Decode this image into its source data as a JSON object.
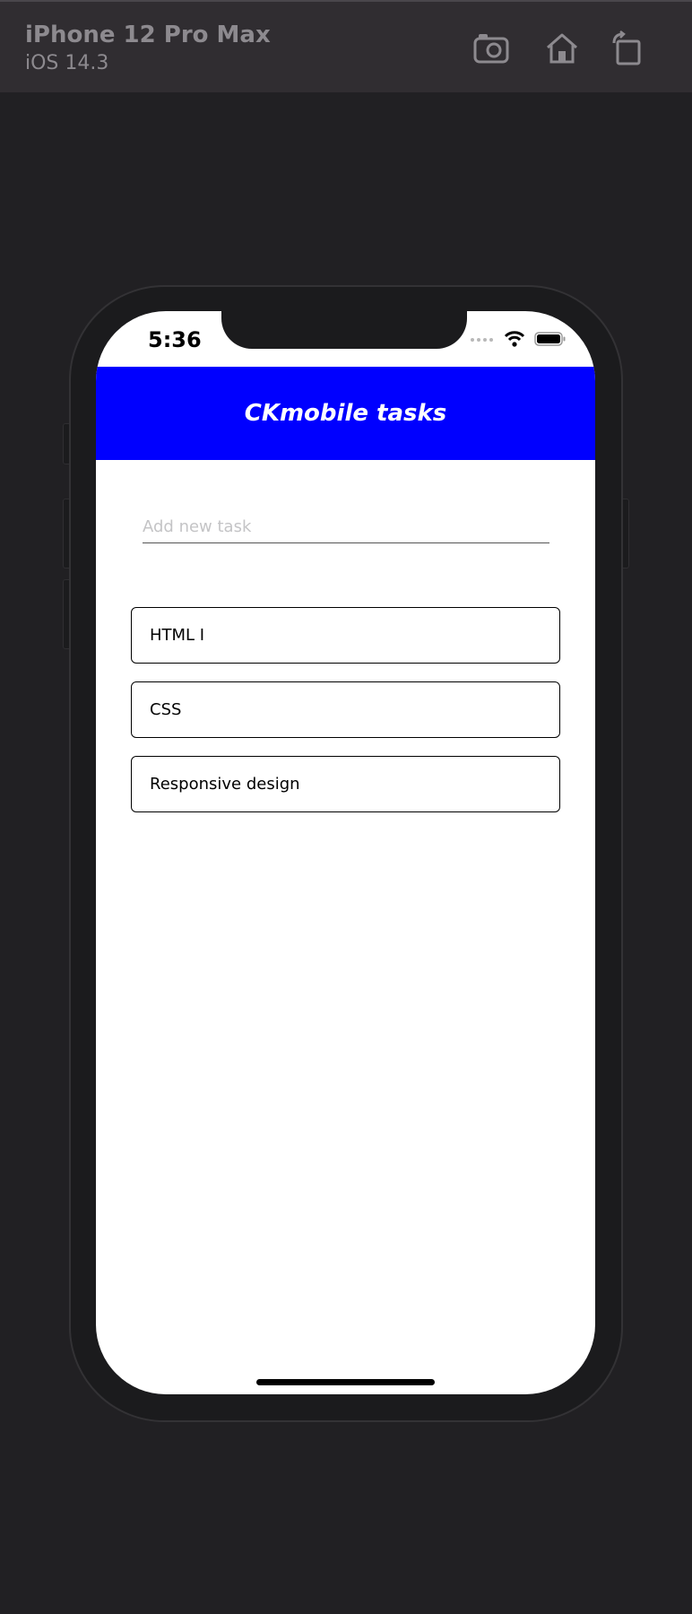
{
  "simulator": {
    "device_name": "iPhone 12 Pro Max",
    "os_version": "iOS 14.3",
    "buttons": [
      {
        "icon": "camera-icon",
        "label": "Screenshot"
      },
      {
        "icon": "home-icon",
        "label": "Home"
      },
      {
        "icon": "rotate-icon",
        "label": "Rotate"
      }
    ]
  },
  "status_bar": {
    "time": "5:36",
    "icons": [
      "signal-dots-icon",
      "wifi-icon",
      "battery-icon"
    ]
  },
  "app": {
    "title": "CKmobile tasks",
    "header_color": "#0000ff",
    "input": {
      "placeholder": "Add new task",
      "value": ""
    },
    "tasks": [
      {
        "label": "HTML I"
      },
      {
        "label": "CSS"
      },
      {
        "label": "Responsive design"
      }
    ]
  }
}
